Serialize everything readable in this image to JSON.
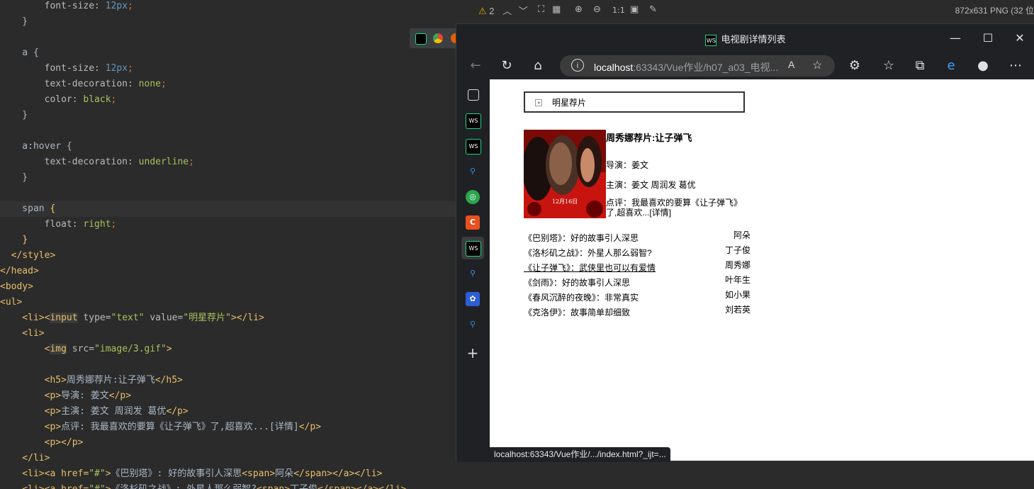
{
  "editor": {
    "lines": [
      {
        "segments": [
          {
            "t": "        font-size: ",
            "c": "t-prop"
          },
          {
            "t": "12px",
            "c": "t-num"
          },
          {
            "t": ";",
            "c": "t-str"
          }
        ]
      },
      {
        "segments": [
          {
            "t": "    }",
            "c": "t-text"
          }
        ]
      },
      {
        "segments": [
          {
            "t": "",
            "c": "t-text"
          }
        ]
      },
      {
        "segments": [
          {
            "t": "    a {",
            "c": "t-sel"
          }
        ]
      },
      {
        "segments": [
          {
            "t": "        font-size: ",
            "c": "t-prop"
          },
          {
            "t": "12px",
            "c": "t-num"
          },
          {
            "t": ";",
            "c": "t-str"
          }
        ]
      },
      {
        "segments": [
          {
            "t": "        text-decoration: ",
            "c": "t-prop"
          },
          {
            "t": "none",
            "c": "t-val"
          },
          {
            "t": ";",
            "c": "t-str"
          }
        ]
      },
      {
        "segments": [
          {
            "t": "        color: ",
            "c": "t-prop"
          },
          {
            "t": "black",
            "c": "t-val"
          },
          {
            "t": ";",
            "c": "t-str"
          }
        ]
      },
      {
        "segments": [
          {
            "t": "    }",
            "c": "t-text"
          }
        ]
      },
      {
        "segments": [
          {
            "t": "",
            "c": "t-text"
          }
        ]
      },
      {
        "segments": [
          {
            "t": "    a:hover {",
            "c": "t-sel"
          }
        ]
      },
      {
        "segments": [
          {
            "t": "        text-decoration: ",
            "c": "t-prop"
          },
          {
            "t": "underline",
            "c": "t-val"
          },
          {
            "t": ";",
            "c": "t-str"
          }
        ]
      },
      {
        "segments": [
          {
            "t": "    }",
            "c": "t-text"
          }
        ]
      },
      {
        "segments": [
          {
            "t": "",
            "c": "t-text"
          }
        ]
      },
      {
        "segments": [
          {
            "t": "    span ",
            "c": "t-sel"
          },
          {
            "t": "{",
            "c": "t-brace-y"
          }
        ]
      },
      {
        "segments": [
          {
            "t": "        float: ",
            "c": "t-prop"
          },
          {
            "t": "right",
            "c": "t-val"
          },
          {
            "t": ";",
            "c": "t-str"
          }
        ]
      },
      {
        "segments": [
          {
            "t": "    ",
            "c": "t-text"
          },
          {
            "t": "}",
            "c": "t-brace-y"
          }
        ]
      },
      {
        "segments": [
          {
            "t": "  </style>",
            "c": "t-tag"
          }
        ]
      },
      {
        "segments": [
          {
            "t": "</head>",
            "c": "t-tag"
          }
        ]
      },
      {
        "segments": [
          {
            "t": "<body>",
            "c": "t-tag"
          }
        ]
      },
      {
        "segments": [
          {
            "t": "<ul>",
            "c": "t-tag"
          }
        ]
      },
      {
        "segments": [
          {
            "t": "    <li><",
            "c": "t-tag"
          },
          {
            "t": "input",
            "c": "t-hl-tag"
          },
          {
            "t": " type=",
            "c": "t-attr"
          },
          {
            "t": "\"text\"",
            "c": "t-val"
          },
          {
            "t": " value=",
            "c": "t-attr"
          },
          {
            "t": "\"明星荐片\"",
            "c": "t-val"
          },
          {
            "t": "></li>",
            "c": "t-tag"
          }
        ]
      },
      {
        "segments": [
          {
            "t": "    <li>",
            "c": "t-tag"
          }
        ]
      },
      {
        "segments": [
          {
            "t": "        <",
            "c": "t-tag"
          },
          {
            "t": "img",
            "c": "t-hl-tag"
          },
          {
            "t": " src=",
            "c": "t-attr"
          },
          {
            "t": "\"image/3.gif\"",
            "c": "t-val"
          },
          {
            "t": ">",
            "c": "t-tag"
          }
        ]
      },
      {
        "segments": [
          {
            "t": "",
            "c": "t-text"
          }
        ]
      },
      {
        "segments": [
          {
            "t": "        <h5>",
            "c": "t-tag"
          },
          {
            "t": "周秀娜荐片:让子弹飞",
            "c": "t-text"
          },
          {
            "t": "</h5>",
            "c": "t-tag"
          }
        ]
      },
      {
        "segments": [
          {
            "t": "        <p>",
            "c": "t-tag"
          },
          {
            "t": "导演: 姜文",
            "c": "t-text"
          },
          {
            "t": "</p>",
            "c": "t-tag"
          }
        ]
      },
      {
        "segments": [
          {
            "t": "        <p>",
            "c": "t-tag"
          },
          {
            "t": "主演: 姜文 周润发 葛优",
            "c": "t-text"
          },
          {
            "t": "</p>",
            "c": "t-tag"
          }
        ]
      },
      {
        "segments": [
          {
            "t": "        <p>",
            "c": "t-tag"
          },
          {
            "t": "点评: 我最喜欢的要算《让子弹飞》了,超喜欢...[详情]",
            "c": "t-text"
          },
          {
            "t": "</p>",
            "c": "t-tag"
          }
        ]
      },
      {
        "segments": [
          {
            "t": "        <p></p>",
            "c": "t-tag"
          }
        ]
      },
      {
        "segments": [
          {
            "t": "    </li>",
            "c": "t-tag"
          }
        ]
      },
      {
        "segments": [
          {
            "t": "    <li><a href=",
            "c": "t-tag"
          },
          {
            "t": "\"#\"",
            "c": "t-val"
          },
          {
            "t": ">",
            "c": "t-tag"
          },
          {
            "t": "《巴别塔》: 好的故事引人深思",
            "c": "t-text"
          },
          {
            "t": "<span>",
            "c": "t-tag"
          },
          {
            "t": "阿朵",
            "c": "t-text"
          },
          {
            "t": "</span></a></li>",
            "c": "t-tag"
          }
        ]
      },
      {
        "segments": [
          {
            "t": "    <li><a href=",
            "c": "t-tag"
          },
          {
            "t": "\"#\"",
            "c": "t-val"
          },
          {
            "t": ">",
            "c": "t-tag"
          },
          {
            "t": "《洛杉矶之战》: 外星人那么弱智?",
            "c": "t-text"
          },
          {
            "t": "<span>",
            "c": "t-tag"
          },
          {
            "t": "丁子俊",
            "c": "t-text"
          },
          {
            "t": "</span></a></li>",
            "c": "t-tag"
          }
        ]
      }
    ]
  },
  "viewer": {
    "warnings": "2",
    "zoom_label": "1:1",
    "image_info": "872x631 PNG (32 位"
  },
  "browser": {
    "title": "电视剧详情列表",
    "address_host": "localhost",
    "address_path": ":63343/Vue作业/h07_a03_电视...",
    "read_aloud": "À",
    "status_url": "localhost:63343/Vue作业/.../index.html?_ijt=..."
  },
  "page": {
    "search_value": "明星荐片",
    "featured": {
      "title": "周秀娜荐片:让子弹飞",
      "director": "导演：姜文",
      "cast": "主演：姜文 周润发 葛优",
      "review": "点评：我最喜欢的要算《让子弹飞》了,超喜欢...[详情]",
      "poster_date": "12月16日"
    },
    "movies": [
      {
        "title": "《巴别塔》：好的故事引人深思",
        "star": "阿朵",
        "hover": false
      },
      {
        "title": "《洛杉矶之战》：外星人那么弱智?",
        "star": "丁子俊",
        "hover": false
      },
      {
        "title": "《让子弹飞》：武侠里也可以有爱情",
        "star": "周秀娜",
        "hover": true
      },
      {
        "title": "《剑雨》：好的故事引人深思",
        "star": "叶年生",
        "hover": false
      },
      {
        "title": "《春风沉醉的夜晚》：非常真实",
        "star": "如小果",
        "hover": false
      },
      {
        "title": "《克洛伊》：故事简单却细致",
        "star": "刘若英",
        "hover": false
      }
    ]
  },
  "colors": {
    "editor_bg": "#2b2b2b",
    "browser_chrome": "#202124",
    "accent_ws": "#21d789"
  }
}
